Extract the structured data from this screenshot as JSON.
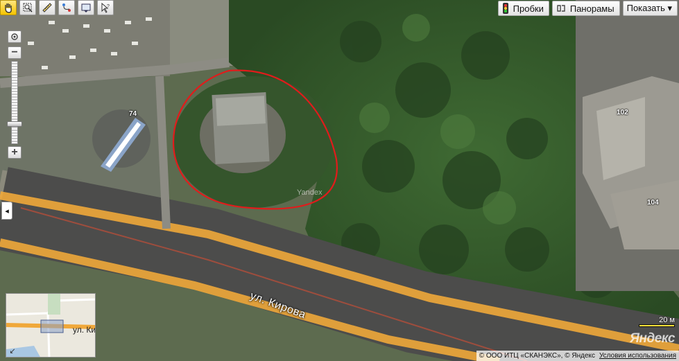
{
  "toolbar": {
    "tools": [
      "hand-tool",
      "magnifier-tool",
      "ruler-tool",
      "route-tool",
      "print-tool",
      "help-tool"
    ]
  },
  "layers": {
    "traffic_label": "Пробки",
    "panoramas_label": "Панорамы",
    "show_label": "Показать ▾"
  },
  "zoom": {
    "in_label": "+",
    "out_label": "−",
    "level_fraction": 0.78
  },
  "map": {
    "street_label": "ул. Кирова",
    "buildings": [
      {
        "number": "74"
      },
      {
        "number": "102"
      },
      {
        "number": "104"
      }
    ],
    "watermark": "Yandex"
  },
  "minimap": {
    "street_label": "ул. Ки",
    "toggle_label": "↙"
  },
  "scale": {
    "label": "20 м"
  },
  "logo": "Яндекс",
  "copyright": {
    "text": "© ООО ИТЦ «СКАНЭКС», © Яндекс",
    "terms_label": "Условия использования"
  },
  "collapse": {
    "label": "◂"
  }
}
